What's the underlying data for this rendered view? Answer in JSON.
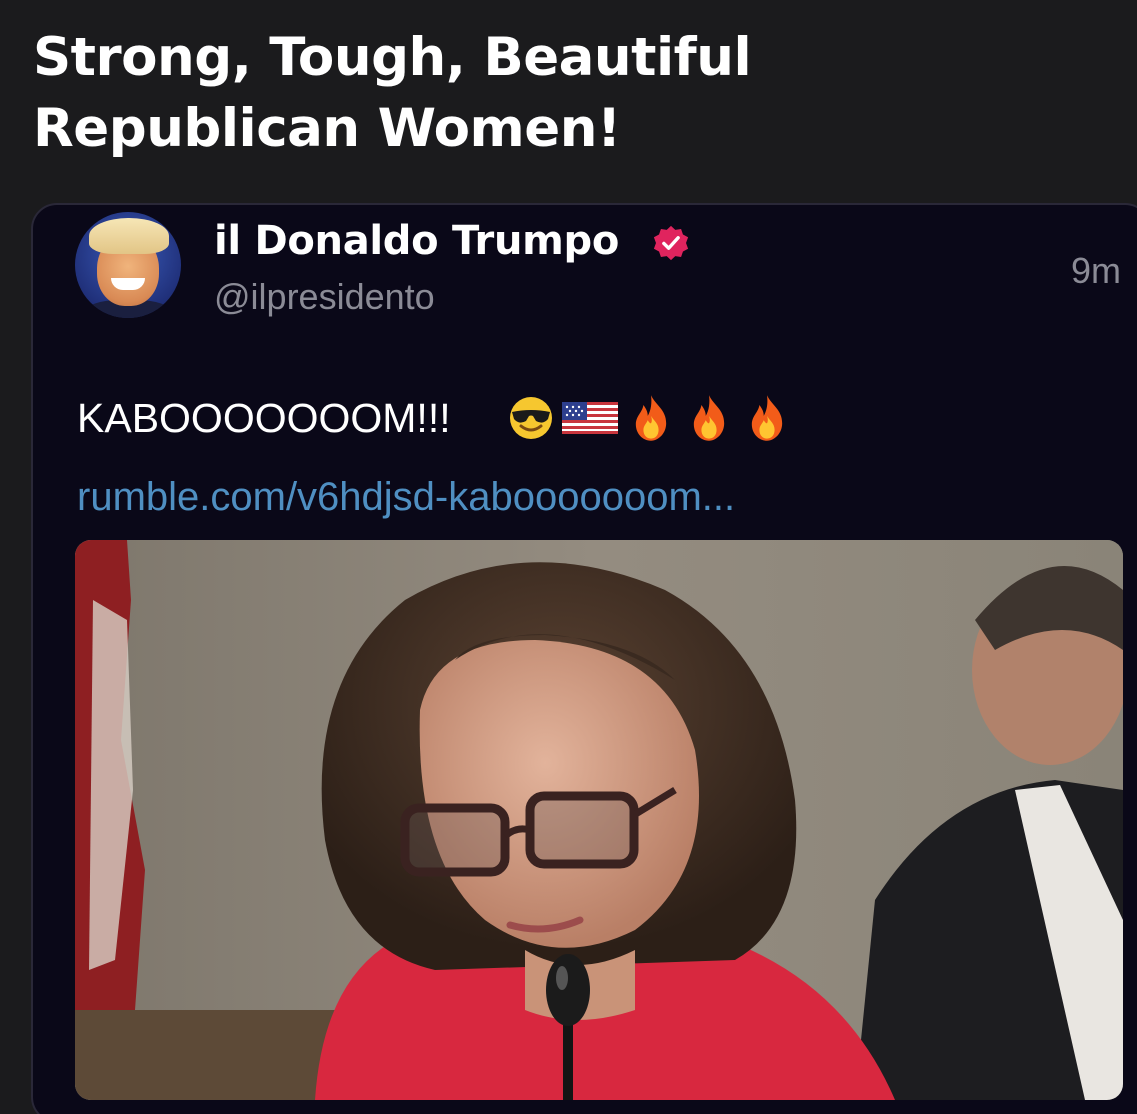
{
  "post": {
    "title": "Strong, Tough, Beautiful Republican Women!"
  },
  "tweet": {
    "display_name": "il Donaldo Trumpo",
    "handle": "@ilpresidento",
    "time": "9m",
    "text": "KABOOOOOOOM!!!",
    "emojis": [
      "smiling-face-with-sunglasses-icon",
      "us-flag-icon",
      "fire-icon",
      "fire-icon",
      "fire-icon"
    ],
    "link": "rumble.com/v6hdjsd-kabooooooom...",
    "verified_badge_color": "#e0245e",
    "link_color": "#4f8fc2"
  }
}
